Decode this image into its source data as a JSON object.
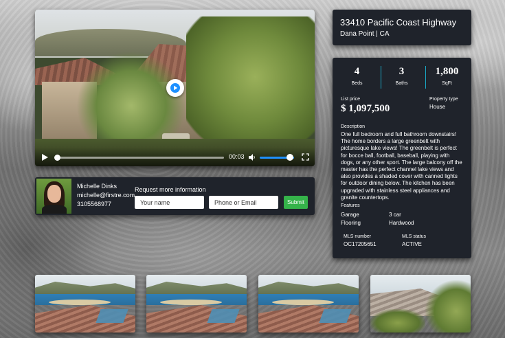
{
  "video": {
    "current_time": "00:03"
  },
  "agent": {
    "name": "Michelle Dinks",
    "email": "michelle@firstre.com",
    "phone": "3105568977"
  },
  "request_form": {
    "title": "Request more information",
    "name_placeholder": "Your name",
    "contact_placeholder": "Phone or Email",
    "submit_label": "Submit"
  },
  "address": {
    "street": "33410 Pacific Coast Highway",
    "city_state": "Dana Point | CA"
  },
  "stats": [
    {
      "value": "4",
      "label": "Beds"
    },
    {
      "value": "3",
      "label": "Baths"
    },
    {
      "value": "1,800",
      "label": "SqFt"
    }
  ],
  "listing": {
    "price_label": "List price",
    "price": "$ 1,097,500",
    "type_label": "Property type",
    "type": "House",
    "description_label": "Description",
    "description": "One full bedroom and full bathroom downstairs! The home borders a large greenbelt with picturesque lake views! The greenbelt is perfect for bocce ball, football, baseball, playing with dogs, or any other sport. The large balcony off the master has the perfect channel lake views and also provides a shaded cover with canned lights for outdoor dining below. The kitchen has been upgraded with stainless steel appliances and granite countertops.",
    "features_label": "Features",
    "features": [
      {
        "name": "Garage",
        "value": "3 car"
      },
      {
        "name": "Flooring",
        "value": "Hardwood"
      }
    ],
    "mls_number_label": "MLS number",
    "mls_number": "OC17205651",
    "mls_status_label": "MLS status",
    "mls_status": "ACTIVE"
  },
  "colors": {
    "panel_bg": "#1f232b",
    "accent": "#1aa7c6",
    "submit": "#35b34a",
    "play": "#1e90ff"
  }
}
